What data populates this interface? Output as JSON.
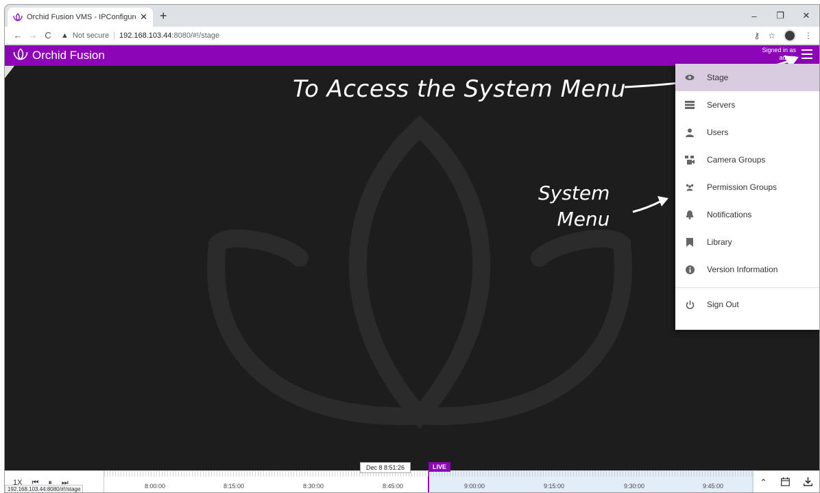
{
  "browser": {
    "tab_title": "Orchid Fusion VMS - IPConfigure",
    "new_tab": "+",
    "not_secure": "Not secure",
    "url_host": "192.168.103.44",
    "url_path": ":8080/#!/stage",
    "win_minimize": "–",
    "win_maximize": "❐",
    "win_close": "✕"
  },
  "app": {
    "brand": "Orchid Fusion",
    "signed_in_label": "Signed in as",
    "signed_in_user": "admin",
    "accent_color": "#8c06b8"
  },
  "annotations": {
    "access_menu": "To Access the System Menu",
    "system_menu_line1": "System",
    "system_menu_line2": "Menu"
  },
  "menu": {
    "items": [
      {
        "label": "Stage",
        "icon": "eye-icon",
        "active": true
      },
      {
        "label": "Servers",
        "icon": "server-icon"
      },
      {
        "label": "Users",
        "icon": "user-icon"
      },
      {
        "label": "Camera Groups",
        "icon": "camera-group-icon"
      },
      {
        "label": "Permission Groups",
        "icon": "people-icon"
      },
      {
        "label": "Notifications",
        "icon": "bell-icon"
      },
      {
        "label": "Library",
        "icon": "bookmark-icon"
      },
      {
        "label": "Version Information",
        "icon": "info-icon"
      }
    ],
    "signout": {
      "label": "Sign Out",
      "icon": "power-icon"
    }
  },
  "timeline": {
    "speed": "1X",
    "current_time": "Dec 8 8:51:26",
    "live_label": "LIVE",
    "labels": [
      "8:00:00",
      "8:15:00",
      "8:30:00",
      "8:45:00",
      "9:00:00",
      "9:15:00",
      "9:30:00",
      "9:45:00"
    ],
    "status_url": "192.168.103.44:8080/#!/stage"
  }
}
